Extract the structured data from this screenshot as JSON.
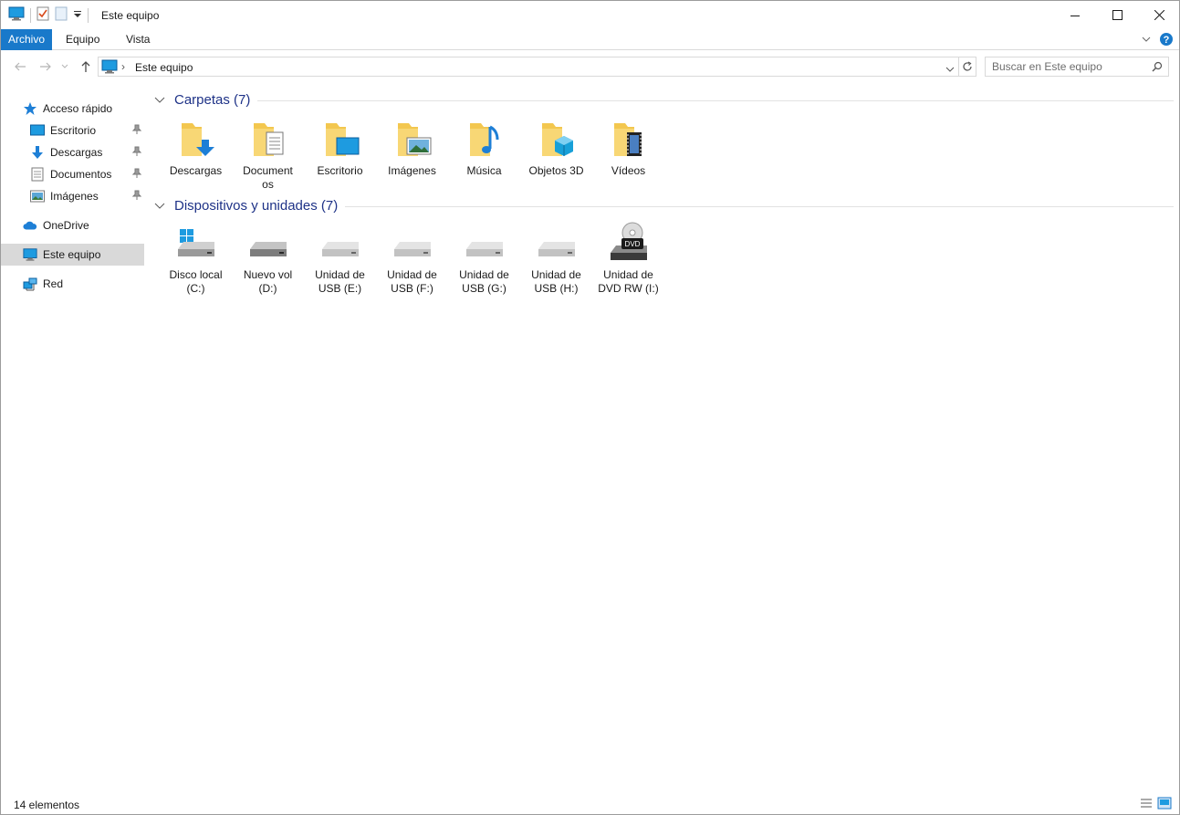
{
  "window": {
    "title": "Este equipo",
    "icon": "computer-icon",
    "controls": [
      "minimize-icon",
      "maximize-icon",
      "close-icon"
    ]
  },
  "ribbon": {
    "tabs": [
      {
        "label": "Archivo"
      },
      {
        "label": "Equipo"
      },
      {
        "label": "Vista"
      }
    ]
  },
  "address": {
    "path": "Este equipo",
    "search_placeholder": "Buscar en Este equipo"
  },
  "sidebar": {
    "quick_access": {
      "label": "Acceso rápido",
      "icon": "star-icon"
    },
    "quick_items": [
      {
        "label": "Escritorio",
        "icon": "desktop-icon"
      },
      {
        "label": "Descargas",
        "icon": "download-icon"
      },
      {
        "label": "Documentos",
        "icon": "document-icon"
      },
      {
        "label": "Imágenes",
        "icon": "image-icon"
      }
    ],
    "onedrive": {
      "label": "OneDrive",
      "icon": "cloud-icon"
    },
    "this_pc": {
      "label": "Este equipo",
      "icon": "computer-icon",
      "selected": true
    },
    "network": {
      "label": "Red",
      "icon": "network-icon"
    }
  },
  "content": {
    "folders_group": {
      "title": "Carpetas (7)"
    },
    "folders": [
      {
        "label": "Descargas",
        "icon": "downloads-folder-icon"
      },
      {
        "label": "Document os",
        "icon": "documents-folder-icon"
      },
      {
        "label": "Escritorio",
        "icon": "desktop-folder-icon"
      },
      {
        "label": "Imágenes",
        "icon": "pictures-folder-icon"
      },
      {
        "label": "Música",
        "icon": "music-folder-icon"
      },
      {
        "label": "Objetos 3D",
        "icon": "3d-objects-folder-icon"
      },
      {
        "label": "Vídeos",
        "icon": "videos-folder-icon"
      }
    ],
    "devices_group": {
      "title": "Dispositivos y unidades (7)"
    },
    "devices": [
      {
        "label": "Disco local (C:)",
        "icon": "system-drive-icon"
      },
      {
        "label": "Nuevo vol (D:)",
        "icon": "hard-drive-icon"
      },
      {
        "label": "Unidad de USB (E:)",
        "icon": "usb-drive-icon"
      },
      {
        "label": "Unidad de USB (F:)",
        "icon": "usb-drive-icon"
      },
      {
        "label": "Unidad de USB (G:)",
        "icon": "usb-drive-icon"
      },
      {
        "label": "Unidad de USB (H:)",
        "icon": "usb-drive-icon"
      },
      {
        "label": "Unidad de DVD RW (I:)",
        "icon": "dvd-drive-icon"
      }
    ]
  },
  "status": {
    "count": "14 elementos"
  },
  "colors": {
    "accent": "#1979ca",
    "group_header": "#1e3287",
    "folder": "#f8d775",
    "selected_bg": "#d9d9d9"
  }
}
